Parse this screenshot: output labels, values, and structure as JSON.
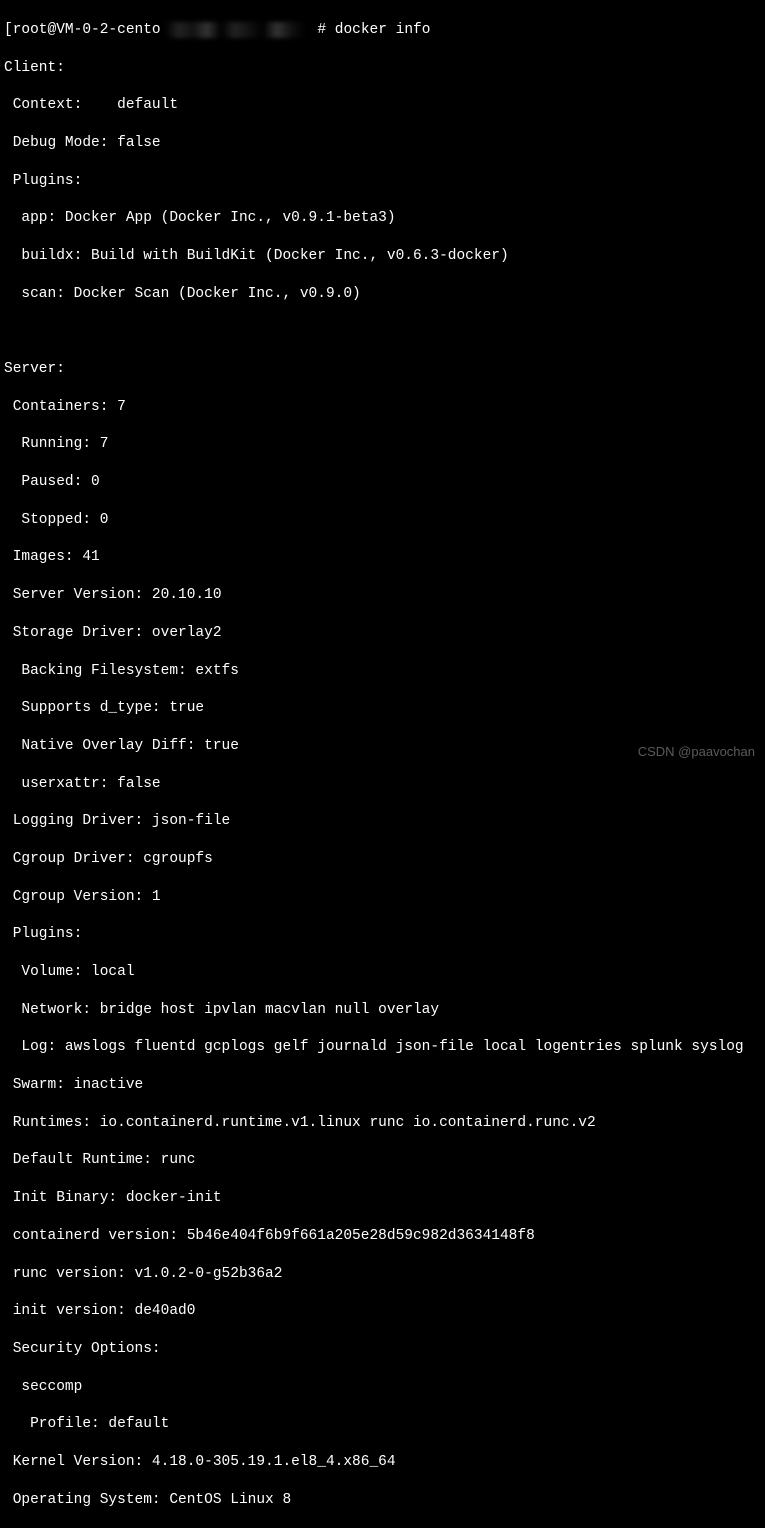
{
  "prompt": {
    "prefix": "[root@VM-0-2-cento",
    "suffix": " # docker info"
  },
  "lines": {
    "l01": "Client:",
    "l02": " Context:    default",
    "l03": " Debug Mode: false",
    "l04": " Plugins:",
    "l05": "  app: Docker App (Docker Inc., v0.9.1-beta3)",
    "l06": "  buildx: Build with BuildKit (Docker Inc., v0.6.3-docker)",
    "l07": "  scan: Docker Scan (Docker Inc., v0.9.0)",
    "l08": " ",
    "l09": "Server:",
    "l10": " Containers: 7",
    "l11": "  Running: 7",
    "l12": "  Paused: 0",
    "l13": "  Stopped: 0",
    "l14": " Images: 41",
    "l15": " Server Version: 20.10.10",
    "l16": " Storage Driver: overlay2",
    "l17": "  Backing Filesystem: extfs",
    "l18": "  Supports d_type: true",
    "l19": "  Native Overlay Diff: true",
    "l20": "  userxattr: false",
    "l21": " Logging Driver: json-file",
    "l22": " Cgroup Driver: cgroupfs",
    "l23": " Cgroup Version: 1",
    "l24": " Plugins:",
    "l25": "  Volume: local",
    "l26": "  Network: bridge host ipvlan macvlan null overlay",
    "l27": "  Log: awslogs fluentd gcplogs gelf journald json-file local logentries splunk syslog",
    "l28": " Swarm: inactive",
    "l29": " Runtimes: io.containerd.runtime.v1.linux runc io.containerd.runc.v2",
    "l30": " Default Runtime: runc",
    "l31": " Init Binary: docker-init",
    "l32": " containerd version: 5b46e404f6b9f661a205e28d59c982d3634148f8",
    "l33": " runc version: v1.0.2-0-g52b36a2",
    "l34": " init version: de40ad0",
    "l35": " Security Options:",
    "l36": "  seccomp",
    "l37": "   Profile: default",
    "l38": " Kernel Version: 4.18.0-305.19.1.el8_4.x86_64",
    "l39": " Operating System: CentOS Linux 8"
  },
  "watermark": "CSDN @paavochan"
}
